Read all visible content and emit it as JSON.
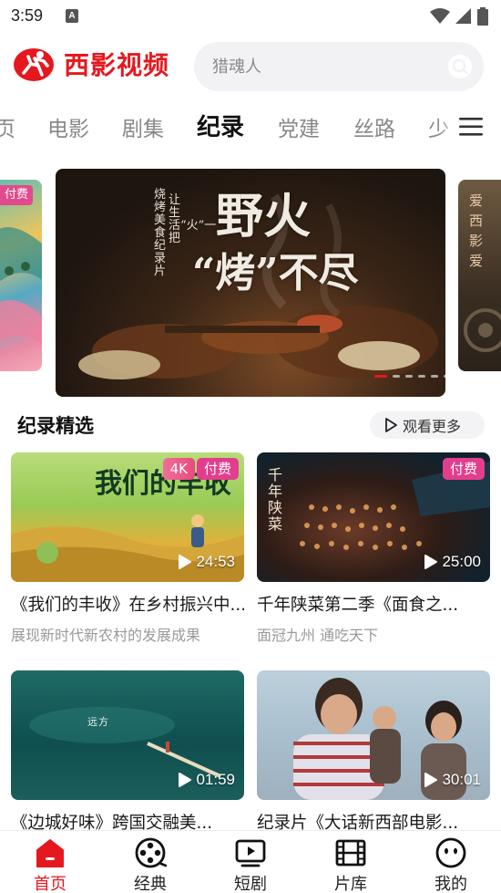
{
  "status_bar": {
    "time": "3:59",
    "indicator": "A"
  },
  "header": {
    "logo_text": "西影视频",
    "search_placeholder": "猎魂人"
  },
  "tabs": [
    {
      "label": "页"
    },
    {
      "label": "电影"
    },
    {
      "label": "剧集"
    },
    {
      "label": "纪录",
      "active": true
    },
    {
      "label": "党建"
    },
    {
      "label": "丝路"
    },
    {
      "label": "少"
    }
  ],
  "carousel": {
    "left_badge": "付费",
    "main": {
      "title_1": "野火",
      "title_2": "“烤”不尽",
      "subtitle_1": "让生活“火”一把",
      "subtitle_2": "烧烤美食纪录片"
    },
    "right_text": "爱西影爱"
  },
  "section": {
    "title": "纪录精选",
    "more_label": "观看更多"
  },
  "cards": [
    {
      "title": "《我们的丰收》在乡村振兴中...",
      "subtitle": "展现新时代新农村的发展成果",
      "duration": "24:53",
      "badges": [
        "4K",
        "付费"
      ],
      "thumb_text": "我们的丰收"
    },
    {
      "title": "千年陕菜第二季《面食之...",
      "subtitle": "面冠九州 通吃天下",
      "duration": "25:00",
      "badges": [
        "付费"
      ],
      "thumb_text": "千年陕菜"
    },
    {
      "title": "《边城好味》跨国交融美...",
      "subtitle": "",
      "duration": "01:59",
      "badges": [],
      "thumb_text": "远方"
    },
    {
      "title": "纪录片《大话新西部电影...",
      "subtitle": "",
      "duration": "30:01",
      "badges": [],
      "thumb_text": ""
    }
  ],
  "bottom_nav": [
    {
      "label": "首页",
      "icon": "home-icon",
      "active": true
    },
    {
      "label": "经典",
      "icon": "film-reel-icon"
    },
    {
      "label": "短剧",
      "icon": "play-screen-icon"
    },
    {
      "label": "片库",
      "icon": "film-strip-icon"
    },
    {
      "label": "我的",
      "icon": "face-icon"
    }
  ],
  "colors": {
    "brand_red": "#e5181f",
    "badge_pink": "#e33e8e",
    "text_gray": "#9a9a9a"
  }
}
